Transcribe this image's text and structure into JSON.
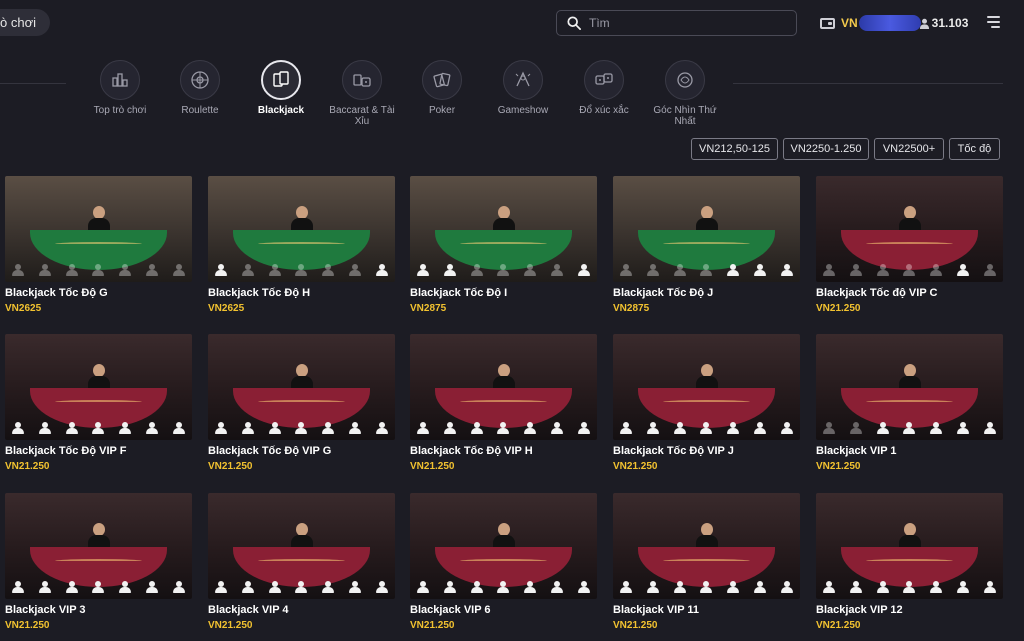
{
  "header": {
    "back_label": "ò chơi",
    "search_placeholder": "Tìm",
    "currency": "VN",
    "balance": "31.103"
  },
  "categories": [
    {
      "label": "Top trò chơi",
      "icon": "top-games-icon",
      "active": false
    },
    {
      "label": "Roulette",
      "icon": "roulette-icon",
      "active": false
    },
    {
      "label": "Blackjack",
      "icon": "blackjack-cards-icon",
      "active": true
    },
    {
      "label": "Baccarat & Tài Xỉu",
      "icon": "baccarat-icon",
      "active": false
    },
    {
      "label": "Poker",
      "icon": "poker-icon",
      "active": false
    },
    {
      "label": "Gameshow",
      "icon": "gameshow-icon",
      "active": false
    },
    {
      "label": "Đổ xúc xắc",
      "icon": "dice-icon",
      "active": false
    },
    {
      "label": "Góc Nhìn Thứ Nhất",
      "icon": "first-person-icon",
      "active": false
    }
  ],
  "filters": [
    "VN212,50-125",
    "VN2250-1.250",
    "VN22500+",
    "Tốc độ"
  ],
  "games": [
    {
      "name": "Blackjack Tốc Độ G",
      "limit": "VN2625",
      "theme": "green",
      "seats": [
        0,
        0,
        0,
        0,
        0,
        0,
        0
      ]
    },
    {
      "name": "Blackjack Tốc Độ H",
      "limit": "VN2625",
      "theme": "green",
      "seats": [
        1,
        0,
        0,
        0,
        0,
        0,
        1
      ]
    },
    {
      "name": "Blackjack Tốc Độ I",
      "limit": "VN2875",
      "theme": "green",
      "seats": [
        1,
        1,
        0,
        0,
        0,
        0,
        1
      ]
    },
    {
      "name": "Blackjack Tốc Độ J",
      "limit": "VN2875",
      "theme": "green",
      "seats": [
        0,
        0,
        0,
        0,
        1,
        1,
        1
      ]
    },
    {
      "name": "Blackjack Tốc độ VIP C",
      "limit": "VN21.250",
      "theme": "red",
      "seats": [
        0,
        0,
        0,
        0,
        0,
        1,
        0
      ]
    },
    {
      "name": "Blackjack Tốc Độ VIP F",
      "limit": "VN21.250",
      "theme": "red",
      "seats": [
        1,
        1,
        1,
        1,
        1,
        1,
        1
      ]
    },
    {
      "name": "Blackjack Tốc Độ VIP G",
      "limit": "VN21.250",
      "theme": "red",
      "seats": [
        1,
        1,
        1,
        1,
        1,
        1,
        1
      ]
    },
    {
      "name": "Blackjack Tốc Độ VIP H",
      "limit": "VN21.250",
      "theme": "red",
      "seats": [
        1,
        1,
        1,
        1,
        1,
        1,
        1
      ]
    },
    {
      "name": "Blackjack Tốc Độ VIP J",
      "limit": "VN21.250",
      "theme": "red",
      "seats": [
        1,
        1,
        1,
        1,
        1,
        1,
        1
      ]
    },
    {
      "name": "Blackjack VIP 1",
      "limit": "VN21.250",
      "theme": "red",
      "seats": [
        0,
        0,
        1,
        1,
        1,
        1,
        1
      ]
    },
    {
      "name": "Blackjack VIP 3",
      "limit": "VN21.250",
      "theme": "red",
      "seats": [
        1,
        1,
        1,
        1,
        1,
        1,
        1
      ]
    },
    {
      "name": "Blackjack VIP 4",
      "limit": "VN21.250",
      "theme": "red",
      "seats": [
        1,
        1,
        1,
        1,
        1,
        1,
        1
      ]
    },
    {
      "name": "Blackjack VIP 6",
      "limit": "VN21.250",
      "theme": "red",
      "seats": [
        1,
        1,
        1,
        1,
        1,
        1,
        1
      ]
    },
    {
      "name": "Blackjack VIP 11",
      "limit": "VN21.250",
      "theme": "red",
      "seats": [
        1,
        1,
        1,
        1,
        1,
        1,
        1
      ]
    },
    {
      "name": "Blackjack VIP 12",
      "limit": "VN21.250",
      "theme": "red",
      "seats": [
        1,
        1,
        1,
        1,
        1,
        1,
        1
      ]
    }
  ],
  "colors": {
    "background": "#1c1c24",
    "limit_text": "#f2c230",
    "currency_text": "#f2c94c"
  }
}
